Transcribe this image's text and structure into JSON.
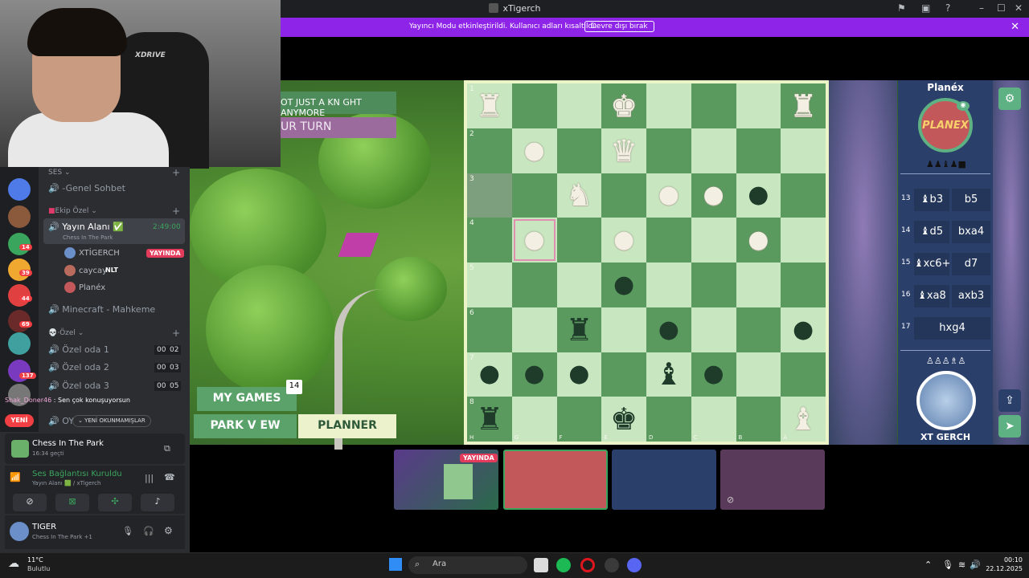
{
  "window": {
    "title": "xTigerch"
  },
  "banner": {
    "message": "Yayıncı Modu etkinleştirildi. Kullanıcı adları kısaltıldı.",
    "button": "Devre dışı bırak",
    "close": "✕"
  },
  "game": {
    "notice": "OT JUST A KN GHT ANYMORE",
    "turn": "UR TURN",
    "buttons": {
      "my_games": "MY GAMES",
      "my_games_count": "14",
      "park_view": "PARK V EW",
      "planner": "PLANNER"
    },
    "opponent": {
      "name": "Planéx",
      "avatar_text": "PLANEX"
    },
    "me": {
      "name": "XT GERCH"
    },
    "moves": [
      {
        "num": "13",
        "white": "♝b3",
        "black": "b5"
      },
      {
        "num": "14",
        "white": "♝d5",
        "black": "bxa4"
      },
      {
        "num": "15",
        "white": "♝xc6+",
        "black": "d7"
      },
      {
        "num": "16",
        "white": "♝xa8",
        "black": "axb3"
      },
      {
        "num": "17",
        "white": "hxg4",
        "black": ""
      }
    ],
    "ranks": [
      "1",
      "2",
      "3",
      "4",
      "5",
      "6",
      "7",
      "8"
    ],
    "files": [
      "H",
      "G",
      "F",
      "E",
      "D",
      "C",
      "B",
      "A"
    ]
  },
  "discord": {
    "sections": {
      "ses": "SES",
      "ekip": "Ekip Özel",
      "ozel": "·Özel"
    },
    "channels": {
      "genel": "-Genel Sohbet",
      "yayin": "Yayın Alanı",
      "yayin_time": "2:49:00",
      "yayin_sub": "Chess In The Park",
      "minecraft": "Minecraft - Mahkeme",
      "oda1": "Özel oda 1",
      "oda1_a": "00",
      "oda1_b": "02",
      "oda2": "Özel oda 2",
      "oda2_a": "00",
      "oda2_b": "03",
      "oda3": "Özel oda 3",
      "oda3_a": "00",
      "oda3_b": "05",
      "oy": "OY"
    },
    "voice_users": [
      {
        "name": "XTİGERCH",
        "badge": "YAYINDA"
      },
      {
        "name": "caycay",
        "badge": "NLT"
      },
      {
        "name": "Planéx",
        "badge": ""
      }
    ],
    "typing": {
      "user": "Shak_Doner46",
      "text": "Sen çok konuşuyorsun"
    },
    "unread": "YENİ OKUNMAMIŞLAR",
    "new_label": "YENİ",
    "server_badges": [
      "14",
      "39",
      "44",
      "69",
      "137"
    ],
    "activity": {
      "title": "Chess In The Park",
      "sub": "16:34 geçti"
    },
    "voice_status": {
      "title": "Ses Bağlantısı Kuruldu",
      "sub": "Yayın Alanı 🟩 / xTigerch"
    },
    "user": {
      "name": "TIGER",
      "sub": "Chess In The Park +1"
    }
  },
  "tiles": {
    "live_label": "YAYINDA"
  },
  "taskbar": {
    "weather_temp": "11°C",
    "weather_desc": "Bulutlu",
    "search": "Ara",
    "time": "00:10",
    "date": "22.12.2025"
  }
}
